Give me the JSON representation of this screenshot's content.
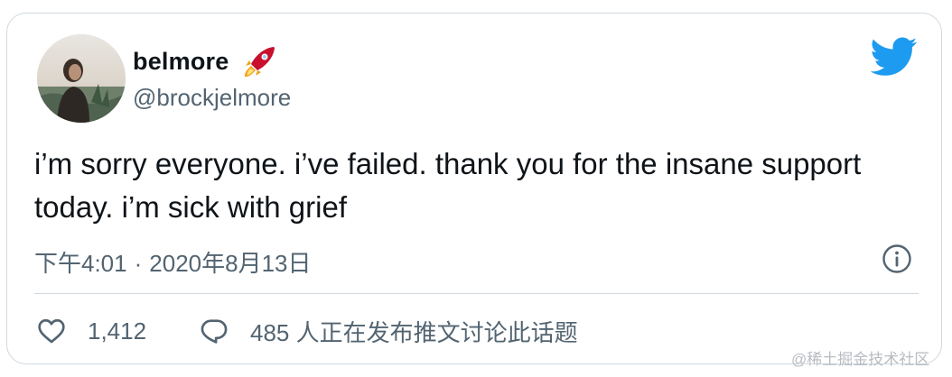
{
  "tweet": {
    "display_name": "belmore",
    "display_name_emoji": "rocket-icon",
    "handle": "@brockjelmore",
    "text": "i’m sorry everyone. i’ve failed. thank you for the insane support today. i’m sick with grief",
    "time": "下午4:01",
    "separator": "·",
    "date": "2020年8月13日"
  },
  "actions": {
    "like_count": "1,412",
    "reply_text": "485 人正在发布推文讨论此话题"
  },
  "watermark": "@稀土掘金技术社区",
  "colors": {
    "twitter_blue": "#1d9bf0",
    "text_primary": "#0f1419",
    "text_secondary": "#536471",
    "border": "#cfd9de"
  },
  "icons": {
    "brand": "twitter-bird-icon",
    "info": "info-icon",
    "like": "heart-icon",
    "reply": "speech-bubble-icon"
  }
}
